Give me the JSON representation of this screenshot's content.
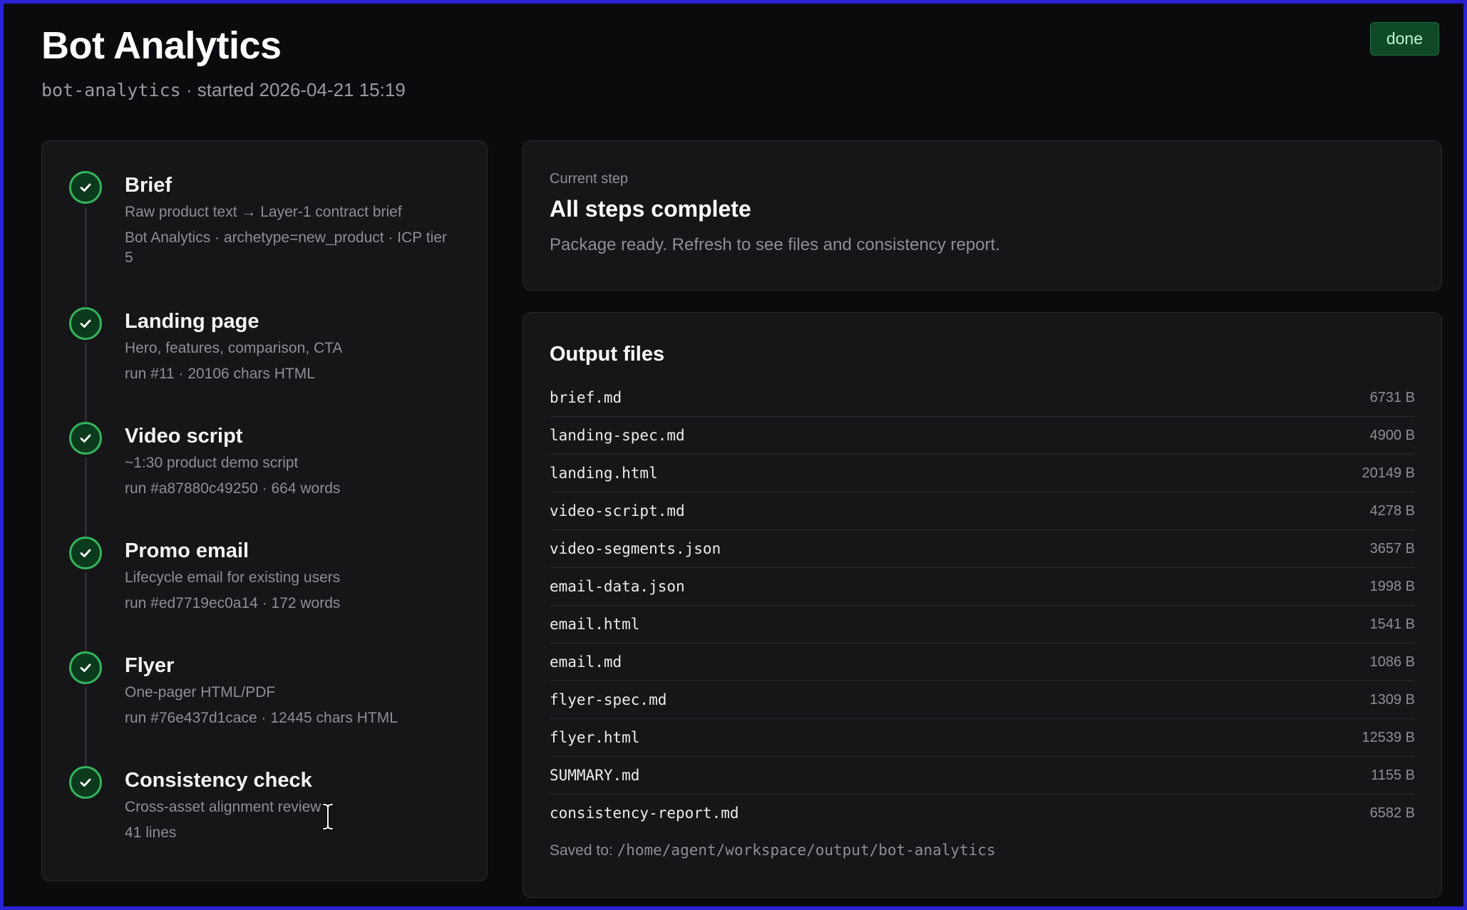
{
  "header": {
    "title": "Bot Analytics",
    "slug": "bot-analytics",
    "started": "· started 2026-04-21 15:19",
    "status": "done"
  },
  "colors": {
    "background": "#0b0b0d",
    "panel": "#161618",
    "success": "#34b35d",
    "badge_bg": "#0f4a26"
  },
  "steps": [
    {
      "title": "Brief",
      "desc": "Raw product text → Layer-1 contract brief",
      "meta": "Bot Analytics · archetype=new_product · ICP tier 5",
      "icon": "check-icon"
    },
    {
      "title": "Landing page",
      "desc": "Hero, features, comparison, CTA",
      "meta": "run #11 · 20106 chars HTML",
      "icon": "check-icon"
    },
    {
      "title": "Video script",
      "desc": "~1:30 product demo script",
      "meta": "run #a87880c49250 · 664 words",
      "icon": "check-icon"
    },
    {
      "title": "Promo email",
      "desc": "Lifecycle email for existing users",
      "meta": "run #ed7719ec0a14 · 172 words",
      "icon": "check-icon"
    },
    {
      "title": "Flyer",
      "desc": "One-pager HTML/PDF",
      "meta": "run #76e437d1cace · 12445 chars HTML",
      "icon": "check-icon"
    },
    {
      "title": "Consistency check",
      "desc": "Cross-asset alignment review",
      "meta": "41 lines",
      "icon": "check-icon"
    }
  ],
  "current": {
    "label": "Current step",
    "title": "All steps complete",
    "desc": "Package ready. Refresh to see files and consistency report."
  },
  "files": {
    "title": "Output files",
    "items": [
      {
        "name": "brief.md",
        "size": "6731 B"
      },
      {
        "name": "landing-spec.md",
        "size": "4900 B"
      },
      {
        "name": "landing.html",
        "size": "20149 B"
      },
      {
        "name": "video-script.md",
        "size": "4278 B"
      },
      {
        "name": "video-segments.json",
        "size": "3657 B"
      },
      {
        "name": "email-data.json",
        "size": "1998 B"
      },
      {
        "name": "email.html",
        "size": "1541 B"
      },
      {
        "name": "email.md",
        "size": "1086 B"
      },
      {
        "name": "flyer-spec.md",
        "size": "1309 B"
      },
      {
        "name": "flyer.html",
        "size": "12539 B"
      },
      {
        "name": "SUMMARY.md",
        "size": "1155 B"
      },
      {
        "name": "consistency-report.md",
        "size": "6582 B"
      }
    ],
    "saved_label": "Saved to:",
    "saved_path": "/home/agent/workspace/output/bot-analytics"
  }
}
